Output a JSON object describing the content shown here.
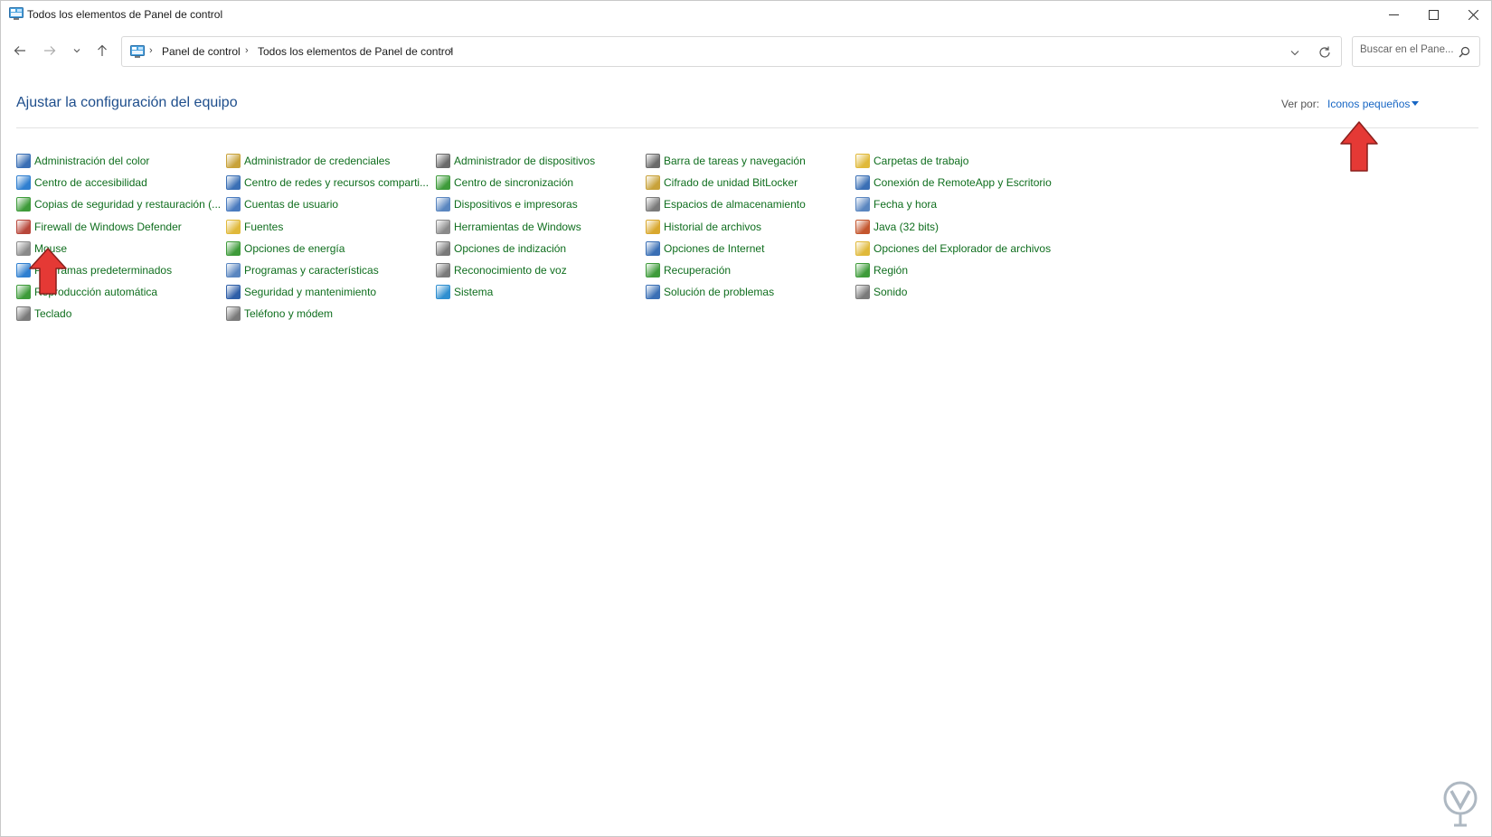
{
  "window": {
    "title": "Todos los elementos de Panel de control"
  },
  "address": {
    "crumbs": [
      "Panel de control",
      "Todos los elementos de Panel de control"
    ]
  },
  "search": {
    "placeholder": "Buscar en el Pane..."
  },
  "header": {
    "title": "Ajustar la configuración del equipo",
    "view_by_label": "Ver por:",
    "view_by_value": "Iconos pequeños"
  },
  "items": [
    {
      "label": "Administración del color",
      "icon": "color-management-icon",
      "color": "#3a6fb5"
    },
    {
      "label": "Centro de accesibilidad",
      "icon": "accessibility-icon",
      "color": "#2f7fd0"
    },
    {
      "label": "Copias de seguridad y restauración (...",
      "icon": "backup-icon",
      "color": "#3e9b3a"
    },
    {
      "label": "Firewall de Windows Defender",
      "icon": "firewall-icon",
      "color": "#b8473b"
    },
    {
      "label": "Mouse",
      "icon": "mouse-icon",
      "color": "#8a8a8a"
    },
    {
      "label": "Programas predeterminados",
      "icon": "default-programs-icon",
      "color": "#2f7fd0"
    },
    {
      "label": "Reproducción automática",
      "icon": "autoplay-icon",
      "color": "#3e9b3a"
    },
    {
      "label": "Teclado",
      "icon": "keyboard-icon",
      "color": "#7a7a7a"
    },
    {
      "label": "Administrador de credenciales",
      "icon": "credential-manager-icon",
      "color": "#c8a23a"
    },
    {
      "label": "Centro de redes y recursos comparti...",
      "icon": "network-center-icon",
      "color": "#3a6fb5"
    },
    {
      "label": "Cuentas de usuario",
      "icon": "user-accounts-icon",
      "color": "#4a7bbf"
    },
    {
      "label": "Fuentes",
      "icon": "fonts-icon",
      "color": "#e0b93a"
    },
    {
      "label": "Opciones de energía",
      "icon": "power-options-icon",
      "color": "#3e9b3a"
    },
    {
      "label": "Programas y características",
      "icon": "programs-features-icon",
      "color": "#5a86c0"
    },
    {
      "label": "Seguridad y mantenimiento",
      "icon": "security-flag-icon",
      "color": "#2f5fa8"
    },
    {
      "label": "Teléfono y módem",
      "icon": "phone-modem-icon",
      "color": "#7a7a7a"
    },
    {
      "label": "Administrador de dispositivos",
      "icon": "device-manager-icon",
      "color": "#6a6a6a"
    },
    {
      "label": "Centro de sincronización",
      "icon": "sync-center-icon",
      "color": "#3e9b3a"
    },
    {
      "label": "Dispositivos e impresoras",
      "icon": "devices-printers-icon",
      "color": "#5a86c0"
    },
    {
      "label": "Herramientas de Windows",
      "icon": "windows-tools-icon",
      "color": "#8a8a8a"
    },
    {
      "label": "Opciones de indización",
      "icon": "indexing-icon",
      "color": "#7a7a7a"
    },
    {
      "label": "Reconocimiento de voz",
      "icon": "microphone-icon",
      "color": "#7a7a7a"
    },
    {
      "label": "Sistema",
      "icon": "system-icon",
      "color": "#2f8fd0"
    },
    {
      "label": "Barra de tareas y navegación",
      "icon": "taskbar-icon",
      "color": "#6a6a6a"
    },
    {
      "label": "Cifrado de unidad BitLocker",
      "icon": "bitlocker-icon",
      "color": "#c8a23a"
    },
    {
      "label": "Espacios de almacenamiento",
      "icon": "storage-spaces-icon",
      "color": "#7a7a7a"
    },
    {
      "label": "Historial de archivos",
      "icon": "file-history-icon",
      "color": "#d9a82e"
    },
    {
      "label": "Opciones de Internet",
      "icon": "internet-options-icon",
      "color": "#3a6fb5"
    },
    {
      "label": "Recuperación",
      "icon": "recovery-icon",
      "color": "#3e9b3a"
    },
    {
      "label": "Solución de problemas",
      "icon": "troubleshooting-icon",
      "color": "#3a6fb5"
    },
    {
      "label": "Carpetas de trabajo",
      "icon": "work-folders-icon",
      "color": "#e0b93a"
    },
    {
      "label": "Conexión de RemoteApp y Escritorio",
      "icon": "remoteapp-icon",
      "color": "#3a6fb5"
    },
    {
      "label": "Fecha y hora",
      "icon": "date-time-icon",
      "color": "#5a86c0"
    },
    {
      "label": "Java (32 bits)",
      "icon": "java-icon",
      "color": "#c4562e"
    },
    {
      "label": "Opciones del Explorador de archivos",
      "icon": "folder-options-icon",
      "color": "#e0b93a"
    },
    {
      "label": "Región",
      "icon": "region-icon",
      "color": "#3e9b3a"
    },
    {
      "label": "Sonido",
      "icon": "sound-icon",
      "color": "#7a7a7a"
    }
  ],
  "accent": "#0f6e1e",
  "annotation_color": "#e53935"
}
